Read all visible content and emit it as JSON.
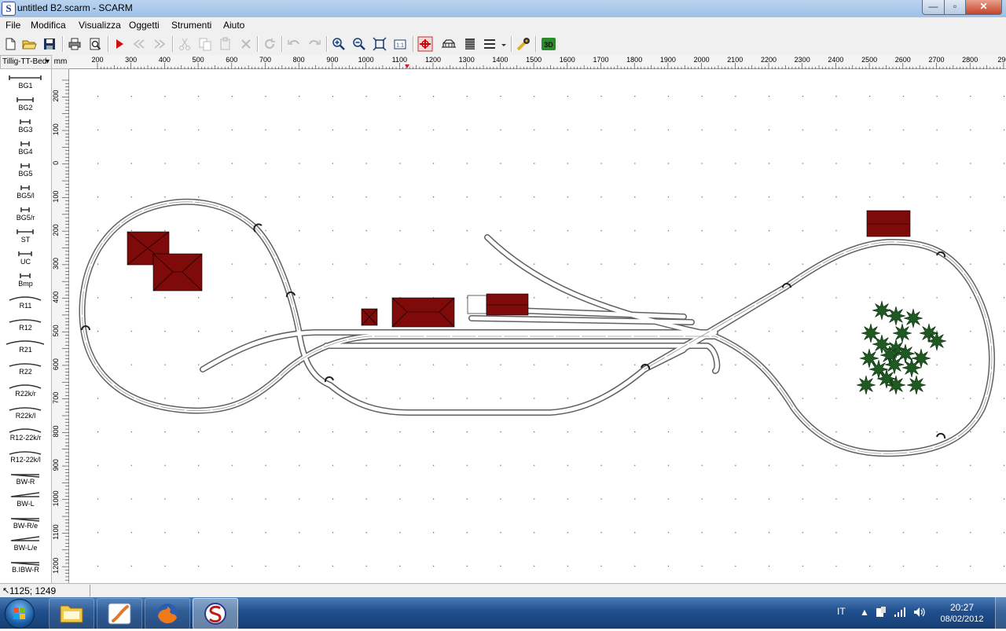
{
  "window": {
    "title": "untitled B2.scarm - SCARM",
    "app_icon_letter": "S",
    "controls": {
      "minimize": "—",
      "maximize": "▫",
      "close": "✕"
    }
  },
  "menu": {
    "items": [
      "File",
      "Modifica",
      "Visualizza",
      "Oggetti",
      "Strumenti",
      "Aiuto"
    ]
  },
  "toolbar": {
    "tools": [
      "new-icon",
      "open-icon",
      "save-icon",
      "print-icon",
      "print-preview-icon",
      "play-icon",
      "rewind-icon",
      "forward-icon",
      "cut-icon",
      "copy-icon",
      "paste-icon",
      "delete-icon",
      "rotate-icon",
      "undo-icon",
      "redo-icon",
      "zoom-in-icon",
      "zoom-out-icon",
      "zoom-fit-icon",
      "zoom-1to1-icon",
      "track-mode-icon",
      "bridge-icon",
      "structure-icon",
      "layers-icon",
      "measure-icon",
      "view-3d-icon"
    ],
    "zoom_1to1_label": "1:1",
    "view_3d_label": "3D"
  },
  "library": {
    "selected": "Tillig-TT-Bed",
    "unit": "mm",
    "items": [
      "BG1",
      "BG2",
      "BG3",
      "BG4",
      "BG5",
      "BG5/l",
      "BG5/r",
      "ST",
      "UC",
      "Bmp",
      "R11",
      "R12",
      "R21",
      "R22",
      "R22k/r",
      "R22k/l",
      "R12-22k/r",
      "R12-22k/l",
      "BW-R",
      "BW-L",
      "BW-R/e",
      "BW-L/e",
      "B.IBW-R"
    ]
  },
  "ruler": {
    "h_ticks": [
      "200",
      "300",
      "400",
      "500",
      "600",
      "700",
      "800",
      "900",
      "1000",
      "1100",
      "1200",
      "1300",
      "1400",
      "1500",
      "1600",
      "1700",
      "1800",
      "1900",
      "2000",
      "2100",
      "2200",
      "2300",
      "2400",
      "2500",
      "2600",
      "2700",
      "2800",
      "290"
    ],
    "v_ticks": [
      "200",
      "100",
      "0",
      "100",
      "200",
      "300",
      "400",
      "500",
      "600",
      "700",
      "800",
      "900",
      "1000",
      "1100",
      "1200"
    ]
  },
  "status": {
    "coords": "1125; 1249"
  },
  "taskbar": {
    "apps": [
      "windows-explorer-icon",
      "paint-icon",
      "firefox-icon",
      "scarm-icon"
    ],
    "language": "IT",
    "time": "20:27",
    "date": "08/02/2012"
  },
  "colors": {
    "building": "#7e0a0a",
    "tree": "#1f5a22",
    "track_rail": "#555555"
  }
}
